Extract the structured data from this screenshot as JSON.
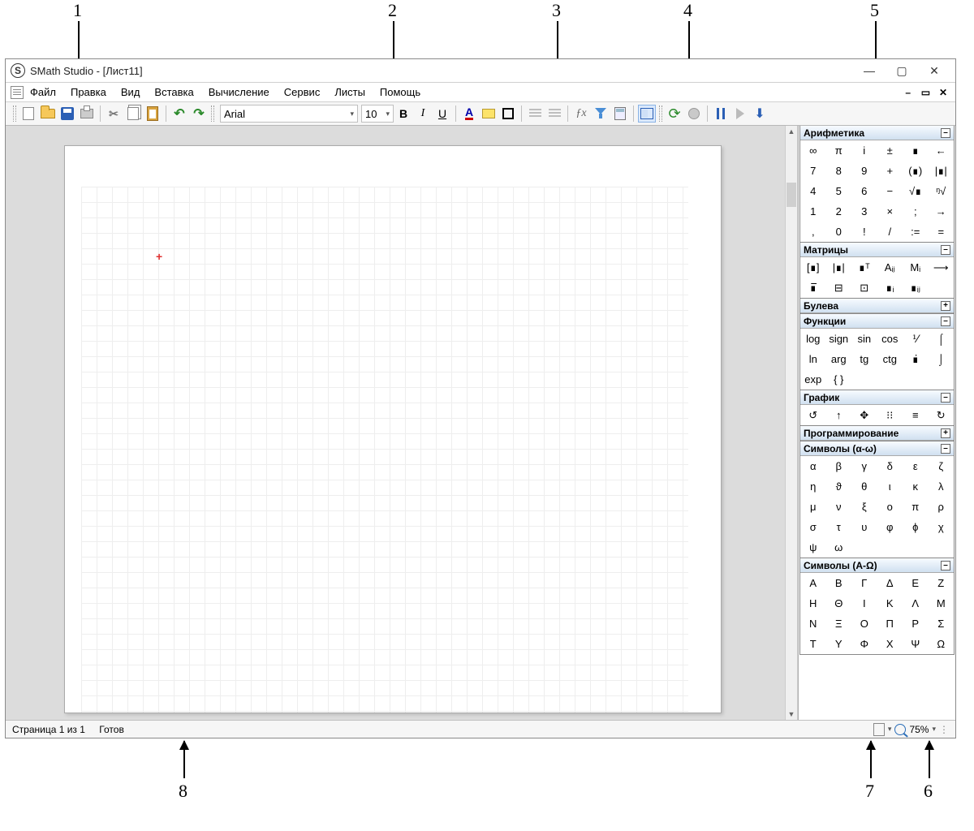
{
  "window": {
    "title": "SMath Studio - [Лист11]",
    "min_glyph": "—",
    "max_glyph": "▢",
    "close_glyph": "✕",
    "mdi_min": "–",
    "mdi_restore": "▭",
    "mdi_close": "✕"
  },
  "menu": {
    "items": [
      "Файл",
      "Правка",
      "Вид",
      "Вставка",
      "Вычисление",
      "Сервис",
      "Листы",
      "Помощь"
    ]
  },
  "toolbar": {
    "font_name": "Arial",
    "font_size": "10",
    "bold": "B",
    "italic": "I",
    "underline": "U",
    "fontcolor_glyph": "A",
    "fx_glyph": "ƒx",
    "cut_glyph": "✂",
    "undo_glyph": "↶",
    "redo_glyph": "↷",
    "refresh_glyph": "⟳",
    "dlstep_glyph": "⬇"
  },
  "palettes": {
    "arithmetic": {
      "title": "Арифметика",
      "toggle": "–",
      "rows": [
        [
          "∞",
          "π",
          "i",
          "±",
          "∎",
          "←"
        ],
        [
          "7",
          "8",
          "9",
          "+",
          "(∎)",
          "|∎|"
        ],
        [
          "4",
          "5",
          "6",
          "−",
          "√∎",
          "ᵑ√"
        ],
        [
          "1",
          "2",
          "3",
          "×",
          ";",
          "→"
        ],
        [
          ",",
          "0",
          "!",
          "/",
          ":=",
          "="
        ]
      ]
    },
    "matrices": {
      "title": "Матрицы",
      "toggle": "–",
      "rows": [
        [
          "[∎]",
          "|∎|",
          "∎ᵀ",
          "Aᵢⱼ",
          "Mᵢ",
          "⟶"
        ],
        [
          "∎̅",
          "⊟",
          "⊡",
          "∎ᵢ",
          "∎ᵢⱼ",
          ""
        ]
      ]
    },
    "boolean": {
      "title": "Булева",
      "toggle": "+"
    },
    "functions": {
      "title": "Функции",
      "toggle": "–",
      "rows": [
        [
          "log",
          "sign",
          "sin",
          "cos",
          "⅟",
          "⌠"
        ],
        [
          "ln",
          "arg",
          "tg",
          "ctg",
          "∎̇",
          "⌡"
        ],
        [
          "exp",
          "{ }",
          "",
          "",
          "",
          ""
        ]
      ]
    },
    "plot": {
      "title": "График",
      "toggle": "–",
      "rows": [
        [
          "↺",
          "↑",
          "✥",
          "⁝⁝",
          "≡",
          "↻"
        ]
      ]
    },
    "programming": {
      "title": "Программирование",
      "toggle": "+"
    },
    "symbols_lower": {
      "title": "Символы (α-ω)",
      "toggle": "–",
      "rows": [
        [
          "α",
          "β",
          "γ",
          "δ",
          "ε",
          "ζ"
        ],
        [
          "η",
          "ϑ",
          "θ",
          "ι",
          "κ",
          "λ"
        ],
        [
          "μ",
          "ν",
          "ξ",
          "ο",
          "π",
          "ρ"
        ],
        [
          "σ",
          "τ",
          "υ",
          "φ",
          "ϕ",
          "χ"
        ],
        [
          "ψ",
          "ω",
          "",
          "",
          "",
          ""
        ]
      ]
    },
    "symbols_upper": {
      "title": "Символы (Α-Ω)",
      "toggle": "–",
      "rows": [
        [
          "Α",
          "Β",
          "Γ",
          "Δ",
          "Ε",
          "Ζ"
        ],
        [
          "Η",
          "Θ",
          "Ι",
          "Κ",
          "Λ",
          "Μ"
        ],
        [
          "Ν",
          "Ξ",
          "Ο",
          "Π",
          "Ρ",
          "Σ"
        ],
        [
          "Τ",
          "Υ",
          "Φ",
          "Χ",
          "Ψ",
          "Ω"
        ]
      ]
    }
  },
  "status": {
    "page": "Страница 1 из 1",
    "state": "Готов",
    "zoom": "75%"
  },
  "callouts": {
    "1": "1",
    "2": "2",
    "3": "3",
    "4": "4",
    "5": "5",
    "6": "6",
    "7": "7",
    "8": "8"
  },
  "misc": {
    "cursor": "+",
    "caret": "▾",
    "dots": "⋮"
  }
}
